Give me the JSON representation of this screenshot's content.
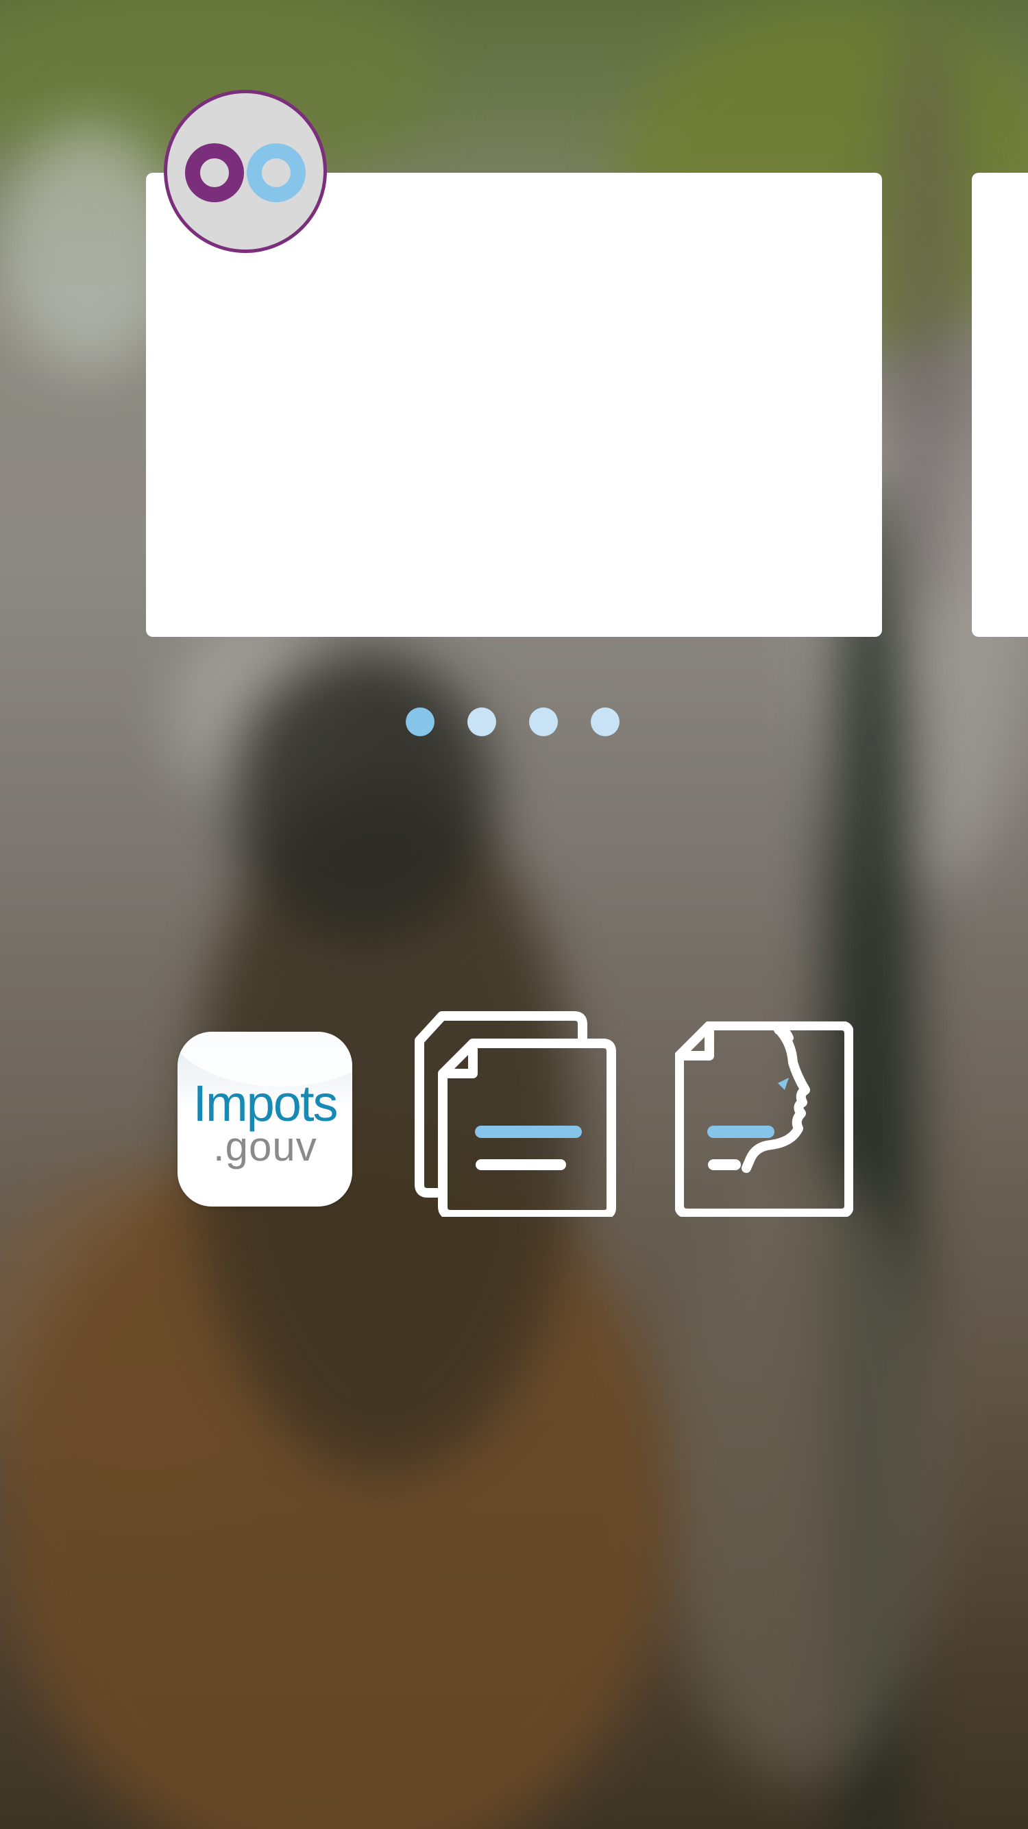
{
  "avatar": {
    "letters": [
      "o",
      "o"
    ],
    "colors": [
      "#7a2e7c",
      "#86c4ea"
    ],
    "ring_color": "#7a2e7c"
  },
  "slider": {
    "pages": 4,
    "active_page": 1,
    "active_color": "#86c4ea",
    "inactive_color": "#c7e3f5"
  },
  "apps": [
    {
      "name": "impots-gouv",
      "icon": "impots-gouv-app-icon",
      "title": "Impots",
      "subtitle": ".gouv",
      "title_color": "#1689b4",
      "subtitle_color": "#8a8a8a"
    },
    {
      "name": "documents",
      "icon": "documents-icon"
    },
    {
      "name": "signed-document",
      "icon": "document-with-face-icon"
    }
  ],
  "accent": "#86c4ea"
}
